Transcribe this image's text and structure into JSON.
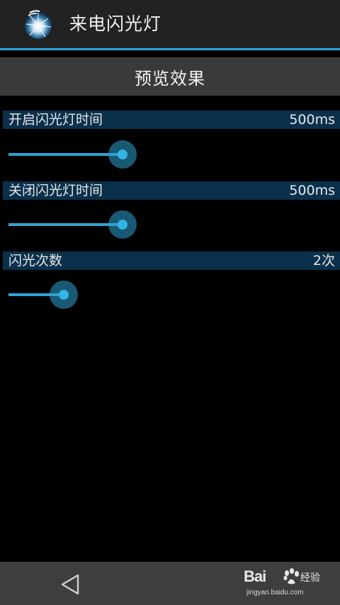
{
  "app": {
    "title": "来电闪光灯",
    "icon": "flash-app-icon"
  },
  "preview_button": {
    "label": "预览效果"
  },
  "settings": [
    {
      "label": "开启闪光灯时间",
      "value": "500ms",
      "slider_fraction": 0.35
    },
    {
      "label": "关闭闪光灯时间",
      "value": "500ms",
      "slider_fraction": 0.35
    },
    {
      "label": "闪光次数",
      "value": "2次",
      "slider_fraction": 0.17
    }
  ],
  "navbar": {
    "back_icon": "back-triangle-icon"
  },
  "watermark": {
    "brand": "Bai",
    "brand_suffix": "经验",
    "url": "jingyan.baidu.com"
  },
  "colors": {
    "accent": "#33b5e5",
    "header_bg": "#0a304b",
    "actionbar_bg": "#222222",
    "preview_bg": "#3a3a3a",
    "navbar_bg": "#3e3e3e"
  }
}
